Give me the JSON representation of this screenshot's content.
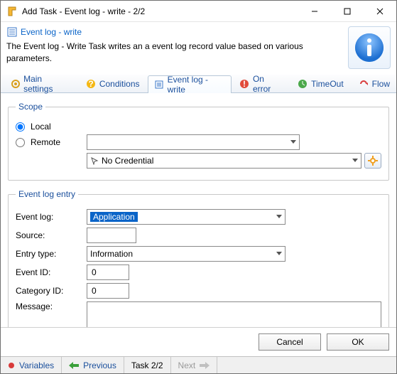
{
  "window": {
    "title": "Add Task - Event log - write - 2/2"
  },
  "header": {
    "title": "Event log - write",
    "description": "The Event log - Write Task writes an a event log record value based on various parameters."
  },
  "tabs": {
    "main": "Main settings",
    "conditions": "Conditions",
    "eventlog": "Event log - write",
    "onerror": "On error",
    "timeout": "TimeOut",
    "flow": "Flow"
  },
  "scope": {
    "legend": "Scope",
    "local": "Local",
    "remote": "Remote",
    "credential": "No Credential"
  },
  "entry": {
    "legend": "Event log entry",
    "eventlog_label": "Event log:",
    "eventlog_value": "Application",
    "source_label": "Source:",
    "source_value": "",
    "entrytype_label": "Entry type:",
    "entrytype_value": "Information",
    "eventid_label": "Event ID:",
    "eventid_value": "0",
    "categoryid_label": "Category ID:",
    "categoryid_value": "0",
    "message_label": "Message:"
  },
  "buttons": {
    "cancel": "Cancel",
    "ok": "OK"
  },
  "status": {
    "variables": "Variables",
    "previous": "Previous",
    "task": "Task 2/2",
    "next": "Next"
  }
}
